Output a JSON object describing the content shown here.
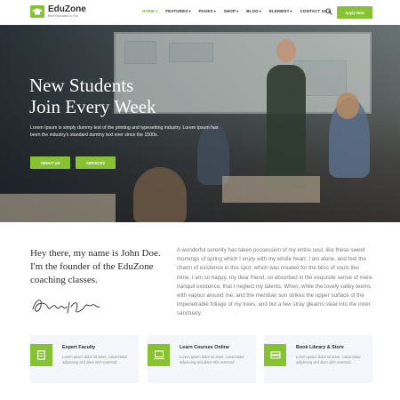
{
  "brand": {
    "name": "EduZone",
    "tagline": "Best Education & Fun",
    "accent_color": "#86c232"
  },
  "nav": {
    "items": [
      {
        "label": "HOME",
        "has_dropdown": true,
        "active": true
      },
      {
        "label": "FEATURES",
        "has_dropdown": true,
        "active": false
      },
      {
        "label": "PAGES",
        "has_dropdown": true,
        "active": false
      },
      {
        "label": "SHOP",
        "has_dropdown": true,
        "active": false
      },
      {
        "label": "BLOG",
        "has_dropdown": true,
        "active": false
      },
      {
        "label": "ELEMENT",
        "has_dropdown": true,
        "active": false
      },
      {
        "label": "CONTACT US",
        "has_dropdown": true,
        "active": false
      }
    ],
    "search_icon": "search-icon",
    "cta_label": "Apply Now"
  },
  "hero": {
    "title_line1": "New Students",
    "title_line2": "Join Every Week",
    "text": "Lorem Ipsum is simply dummy text of the printing and typesetting industry. Lorem Ipsum has been the industry's standard dummy text ever since the 1500s.",
    "button_about": "ABOUT US",
    "button_services": "SERVICES"
  },
  "about": {
    "heading": "Hey there, my name is John Doe. I'm the founder of the EduZone coaching classes.",
    "paragraph": "A wonderful serenity has taken possession of my entire soul, like these sweet mornings of spring which I enjoy with my whole heart. I am alone, and feel the charm of existence in this spot, which was created for the bliss of souls like mine. I am so happy, my dear friend, so absorbed in the exquisite sense of mere tranquil existence, that I neglect my talents. When, while the lovely valley teems with vapour around me, and the meridian sun strikes the upper surface of the impenetrable foliage of my trees, and but a few stray gleams steal into the inner sanctuary."
  },
  "features": [
    {
      "icon": "book-icon",
      "title": "Expert Faculty",
      "desc": "Lorem ipsum dolor sit amet, consectetur adipiscing sed diam nibh euismod."
    },
    {
      "icon": "laptop-icon",
      "title": "Learn Courses Online",
      "desc": "Lorem ipsum dolor sit amet, consectetur adipiscing sed diam nibh euismod."
    },
    {
      "icon": "library-icon",
      "title": "Book Library & Store",
      "desc": "Lorem ipsum dolor sit amet, consectetur adipiscing sed diam nibh euismod."
    }
  ]
}
